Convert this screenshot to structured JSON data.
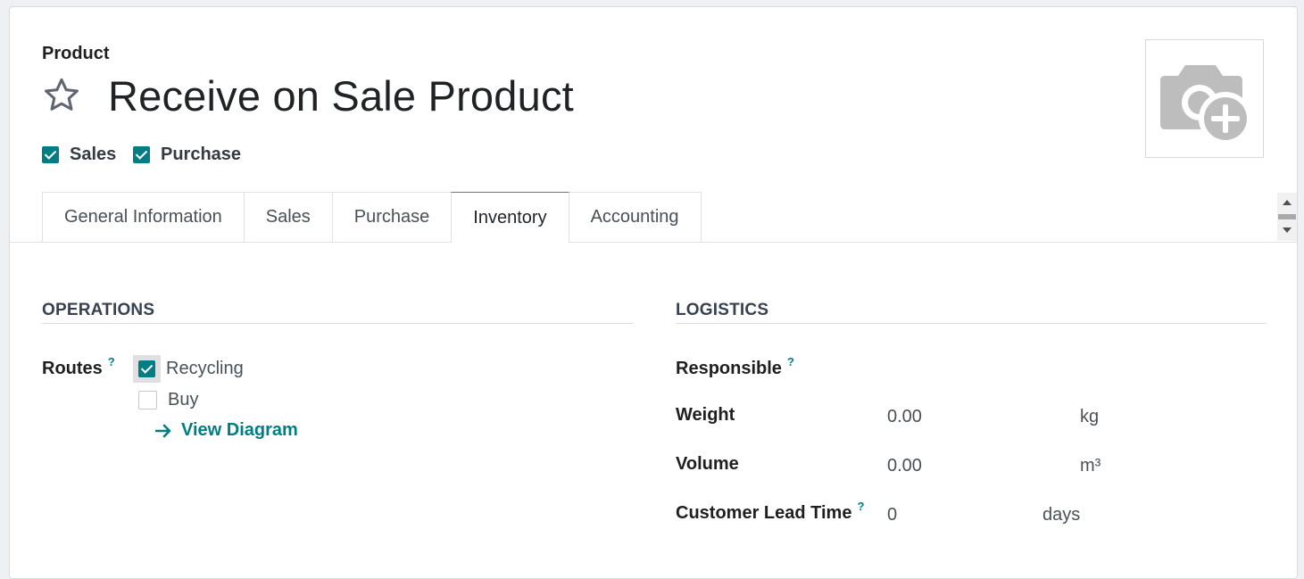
{
  "header": {
    "model_label": "Product",
    "title": "Receive on Sale Product"
  },
  "options": [
    {
      "label": "Sales",
      "checked": true
    },
    {
      "label": "Purchase",
      "checked": true
    }
  ],
  "photo": {
    "icon": "camera-plus-icon"
  },
  "tabs": [
    {
      "label": "General Information",
      "active": false
    },
    {
      "label": "Sales",
      "active": false
    },
    {
      "label": "Purchase",
      "active": false
    },
    {
      "label": "Inventory",
      "active": true
    },
    {
      "label": "Accounting",
      "active": false
    }
  ],
  "operations": {
    "title": "OPERATIONS",
    "routes_label": "Routes",
    "help": "?",
    "routes": [
      {
        "label": "Recycling",
        "checked": true
      },
      {
        "label": "Buy",
        "checked": false
      }
    ],
    "view_diagram": "View Diagram"
  },
  "logistics": {
    "title": "LOGISTICS",
    "help": "?",
    "responsible_label": "Responsible",
    "weight_label": "Weight",
    "weight_value": "0.00",
    "weight_unit": "kg",
    "volume_label": "Volume",
    "volume_value": "0.00",
    "volume_unit": "m³",
    "lead_time_label": "Customer Lead Time",
    "lead_time_value": "0",
    "lead_time_unit": "days"
  },
  "colors": {
    "accent": "#017e84",
    "text": "#212529",
    "muted": "#495057"
  }
}
